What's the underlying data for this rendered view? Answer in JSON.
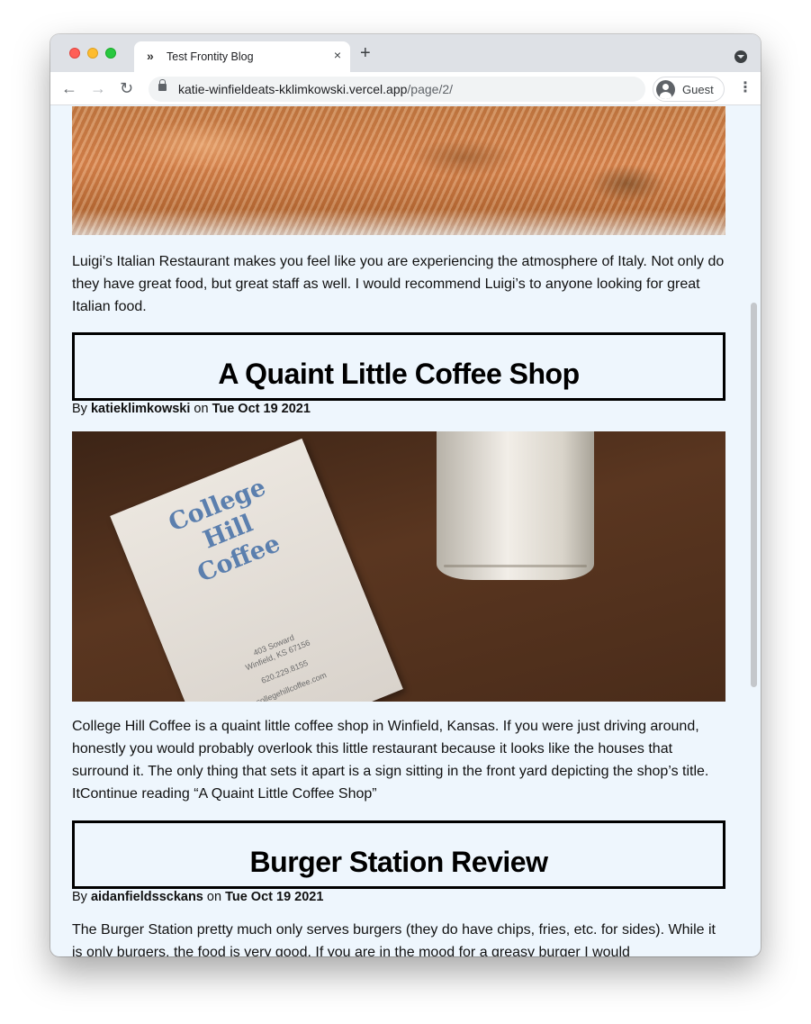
{
  "browser": {
    "tab_title": "Test Frontity Blog",
    "tab_favicon": "»",
    "tab_close": "×",
    "new_tab": "+",
    "url_host": "katie-winfieldeats-kklimkowski.vercel.app",
    "url_path": "/page/2/",
    "profile_label": "Guest",
    "nav": {
      "back": "←",
      "forward": "→",
      "reload": "↻",
      "menu": "⋮"
    },
    "icons": [
      "back-arrow-icon",
      "forward-arrow-icon",
      "reload-icon",
      "lock-icon",
      "profile-icon",
      "more-menu-icon",
      "tab-search-icon"
    ]
  },
  "posts": [
    {
      "excerpt": "Luigi’s Italian Restaurant makes you feel like you are experiencing the atmosphere of Italy. Not only do they have great food, but great staff as well. I would recommend Luigi’s to anyone looking for great Italian food."
    },
    {
      "title": "A Quaint Little Coffee Shop",
      "by": "By",
      "author": "katieklimkowski",
      "on": "on",
      "date": "Tue Oct 19 2021",
      "image_text": {
        "word1": "College",
        "word2": "Hill",
        "word3": "Coffee",
        "address1": "403 Soward",
        "address2": "Winfield, KS 67156",
        "phone": "620.229.8155",
        "site": "collegehillcoffee.com"
      },
      "excerpt": "College Hill Coffee is a quaint little coffee shop in Winfield, Kansas. If you were just driving around, honestly you would probably overlook this little restaurant because it looks like the houses that surround it. The only thing that sets it apart is a sign sitting in the front yard depicting the shop’s title. ItContinue reading “A Quaint Little Coffee Shop”"
    },
    {
      "title": "Burger Station Review",
      "by": "By",
      "author": "aidanfieldssckans",
      "on": "on",
      "date": "Tue Oct 19 2021",
      "excerpt": "The Burger Station pretty much only serves burgers (they do have chips, fries, etc. for sides). While it is only burgers, the food is very good. If you are in the mood for a greasy burger I would"
    }
  ],
  "colors": {
    "page_background": "#eef6fd",
    "tabstrip": "#dee1e6",
    "title_border": "#000000"
  }
}
